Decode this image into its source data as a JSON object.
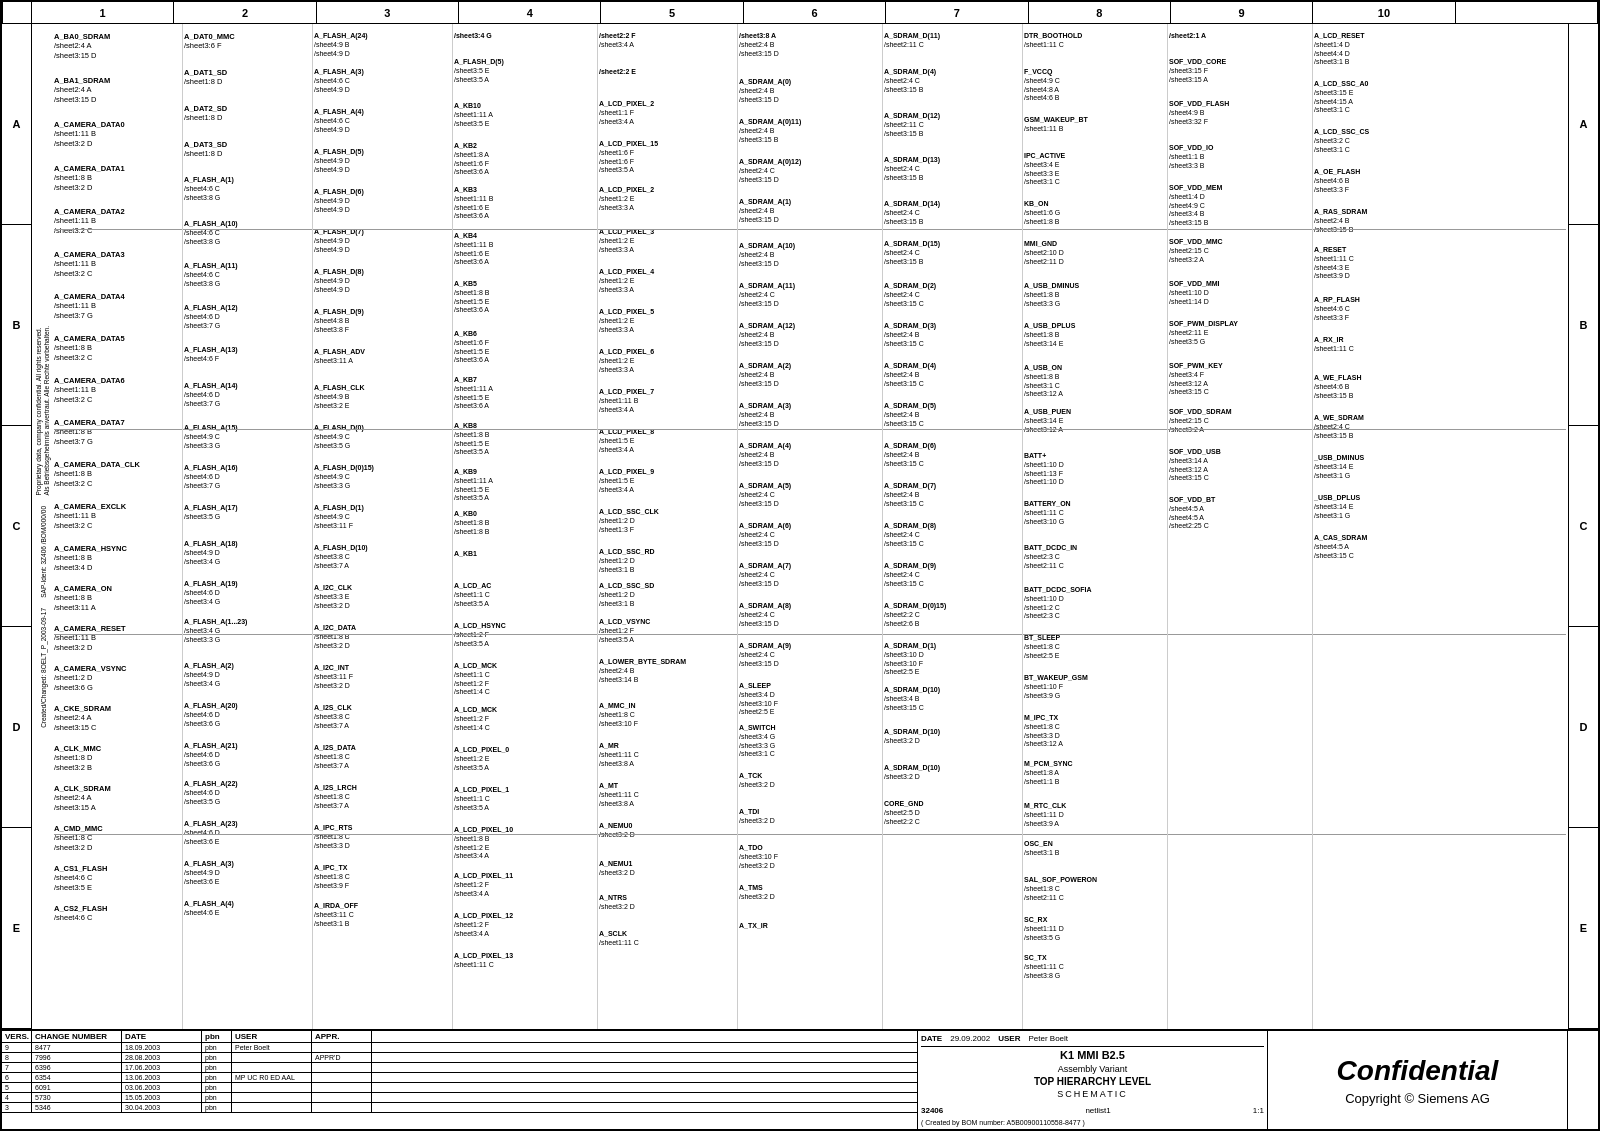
{
  "title": "K1 MMI B2.5",
  "description": "TOP HIERARCHY LEVEL",
  "doc_type": "SCHEMATIC",
  "doc_number": "32406",
  "scale": "1:1",
  "company": "Siemens AG",
  "date": "29.09.2002",
  "created_by": "Created by BOM number: A5B00900110558-8477",
  "netlist": "netlist1",
  "confidential_label": "Confidential",
  "copyright_label": "Copyright © Siemens AG",
  "col_numbers": [
    "",
    "1",
    "2",
    "3",
    "4",
    "5",
    "6",
    "7",
    "8",
    "9",
    "10",
    ""
  ],
  "row_letters": [
    "A",
    "B",
    "C",
    "D",
    "E"
  ],
  "revisions": [
    {
      "vers": "9",
      "change_number": "8477",
      "date": "18.09.2003",
      "pbn": "pbn",
      "user": "",
      "appr": ""
    },
    {
      "vers": "8",
      "change_number": "7996",
      "date": "28.08.2003",
      "pbn": "pbn",
      "user": "",
      "appr": "APPR'D"
    },
    {
      "vers": "7",
      "change_number": "6396",
      "date": "17.06.2003",
      "pbn": "pbn",
      "user": "",
      "appr": ""
    },
    {
      "vers": "6",
      "change_number": "6354",
      "date": "13.06.2003",
      "pbn": "pbn",
      "user": "MP UC R0 ED AAL",
      "appr": ""
    },
    {
      "vers": "5",
      "change_number": "6091",
      "date": "03.06.2003",
      "pbn": "pbn",
      "user": "",
      "appr": ""
    },
    {
      "vers": "4",
      "change_number": "5730",
      "date": "15.05.2003",
      "pbn": "pbn",
      "user": "",
      "appr": ""
    },
    {
      "vers": "3",
      "change_number": "5346",
      "date": "30.04.2003",
      "pbn": "pbn",
      "user": "",
      "appr": ""
    }
  ],
  "proprietary_notice": "Proprietary data, company confidential. All rights reserved.",
  "als_notice": "Als Betriebsgeheimnis anvertraut. Alle Rechte vorbehalten.",
  "sap_ident": "SAP-Ident: 3Z406 /BOM/000/00",
  "title_fields": {
    "date_label": "DATE",
    "user_label": "USER",
    "vers_label": "VERS.",
    "change_label": "CHANGE NUMBER",
    "date_val": "29.09.2002",
    "user_val": "Peter Boelt"
  }
}
